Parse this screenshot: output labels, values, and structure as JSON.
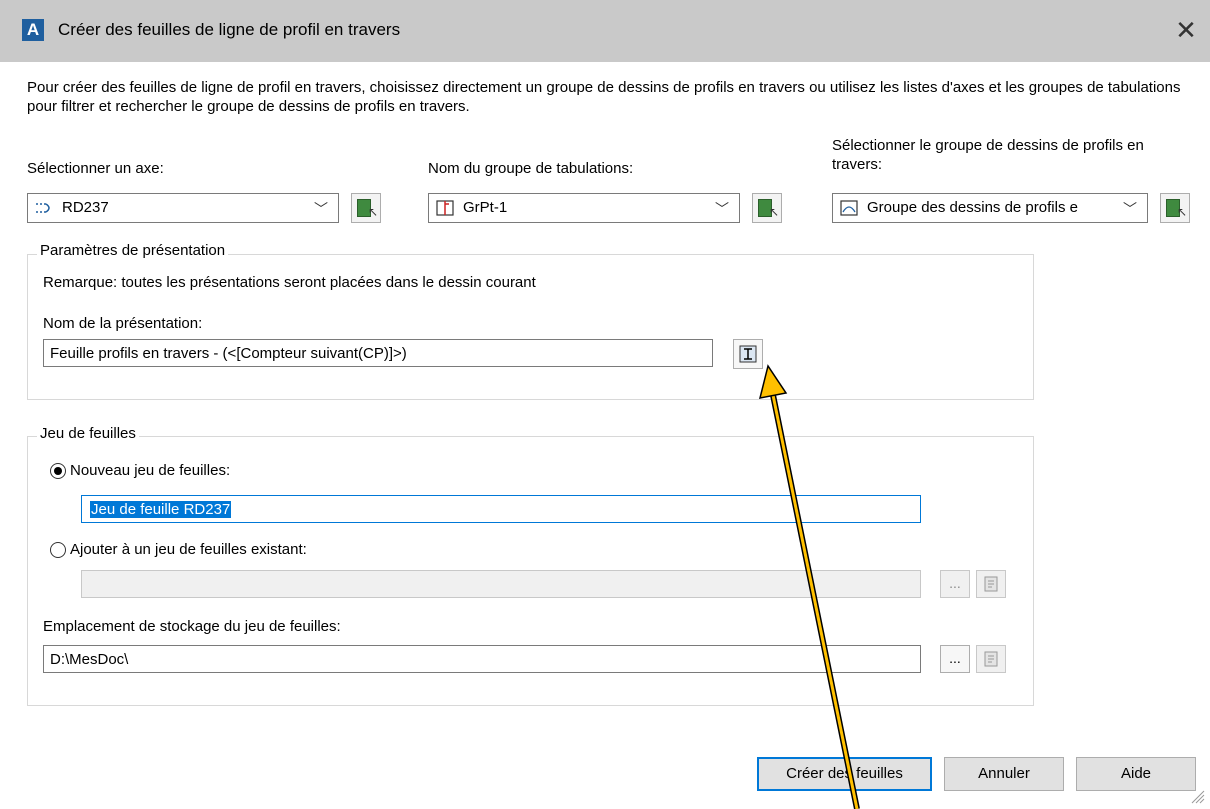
{
  "window": {
    "title": "Créer des feuilles de ligne de profil en travers",
    "app_icon_letter": "A",
    "close_glyph": "✕"
  },
  "description": "Pour créer des feuilles de ligne de profil en travers, choisissez directement un groupe de dessins de profils en travers ou utilisez les listes d'axes et les groupes de tabulations pour filtrer et rechercher le groupe de dessins de profils en travers.",
  "axis": {
    "label": "Sélectionner un axe:",
    "value": "RD237"
  },
  "tab_group": {
    "label": "Nom du groupe de tabulations:",
    "value": "GrPt-1"
  },
  "drawing_group": {
    "label": "Sélectionner le groupe de dessins de profils en travers:",
    "value": "Groupe des dessins de profils e"
  },
  "presentation": {
    "group_label": "Paramètres de présentation",
    "note": "Remarque: toutes les présentations seront placées dans le dessin courant",
    "name_label": "Nom de la présentation:",
    "name_value": "Feuille profils en travers - (<[Compteur suivant(CP)]>)"
  },
  "sheet_set": {
    "group_label": "Jeu de feuilles",
    "new_label": "Nouveau jeu de feuilles:",
    "new_value": "Jeu de feuille RD237",
    "new_selected": true,
    "existing_label": "Ajouter à un jeu de feuilles existant:",
    "existing_value": "",
    "browse_label": "...",
    "storage_label": "Emplacement de stockage du jeu de feuilles:",
    "storage_value": "D:\\MesDoc\\"
  },
  "buttons": {
    "create": "Créer des feuilles",
    "cancel": "Annuler",
    "help": "Aide"
  },
  "annotation": {
    "arrow_color": "#ffc000"
  }
}
